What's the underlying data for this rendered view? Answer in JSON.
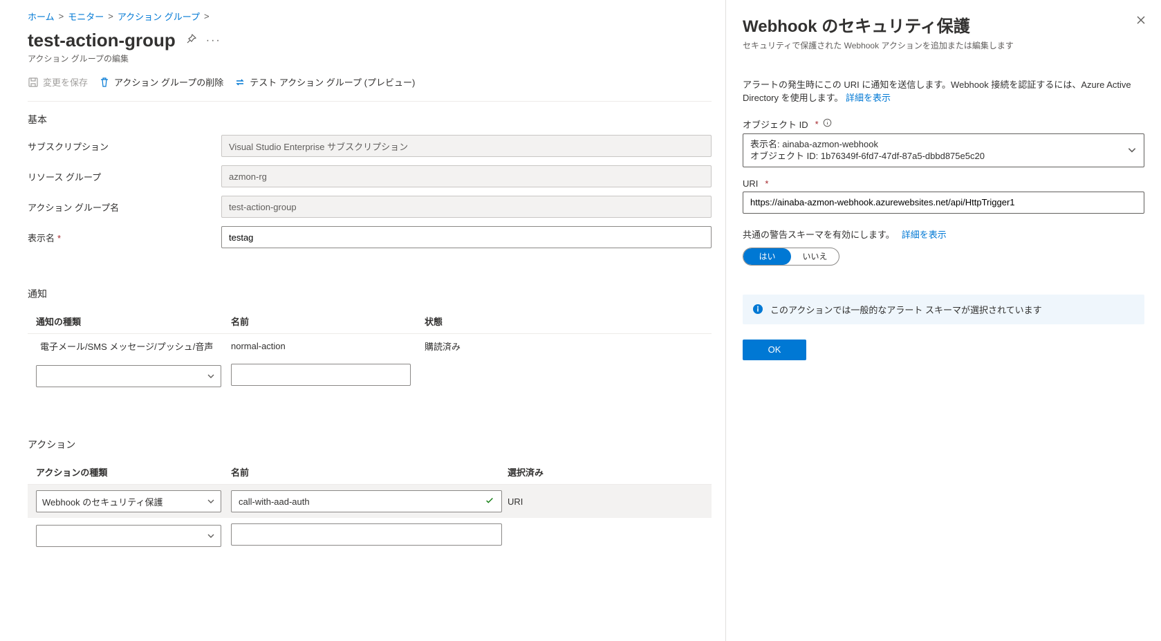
{
  "breadcrumbs": {
    "home": "ホーム",
    "monitor": "モニター",
    "actionGroups": "アクション グループ"
  },
  "page": {
    "title": "test-action-group",
    "subtitle": "アクション グループの編集"
  },
  "toolbar": {
    "save": "変更を保存",
    "delete": "アクション グループの削除",
    "test": "テスト アクション グループ (プレビュー)"
  },
  "basic": {
    "section": "基本",
    "subscriptionLabel": "サブスクリプション",
    "subscriptionValue": "Visual Studio Enterprise サブスクリプション",
    "resourceGroupLabel": "リソース グループ",
    "resourceGroupValue": "azmon-rg",
    "actionGroupNameLabel": "アクション グループ名",
    "actionGroupNameValue": "test-action-group",
    "displayNameLabel": "表示名",
    "displayNameValue": "testag"
  },
  "notifications": {
    "section": "通知",
    "colType": "通知の種類",
    "colName": "名前",
    "colState": "状態",
    "rows": [
      {
        "type": "電子メール/SMS メッセージ/プッシュ/音声",
        "name": "normal-action",
        "state": "購読済み"
      }
    ]
  },
  "actions": {
    "section": "アクション",
    "colType": "アクションの種類",
    "colName": "名前",
    "colSelected": "選択済み",
    "rows": [
      {
        "type": "Webhook のセキュリティ保護",
        "name": "call-with-aad-auth",
        "selected": "URI"
      }
    ]
  },
  "panel": {
    "title": "Webhook のセキュリティ保護",
    "subtitle": "セキュリティで保護された Webhook アクションを追加または編集します",
    "descPrefix": "アラートの発生時にこの URI に通知を送信します。Webhook 接続を認証するには、Azure Active Directory を使用します。 ",
    "learnMore": "詳細を表示",
    "objectIdLabel": "オブジェクト ID",
    "objectDisplayName": "表示名: ainaba-azmon-webhook",
    "objectIdValue": "オブジェクト ID: 1b76349f-6fd7-47df-87a5-dbbd875e5c20",
    "uriLabel": "URI",
    "uriValue": "https://ainaba-azmon-webhook.azurewebsites.net/api/HttpTrigger1",
    "schemaLabel": "共通の警告スキーマを有効にします。",
    "yes": "はい",
    "no": "いいえ",
    "infoMsg": "このアクションでは一般的なアラート スキーマが選択されています",
    "okBtn": "OK"
  }
}
